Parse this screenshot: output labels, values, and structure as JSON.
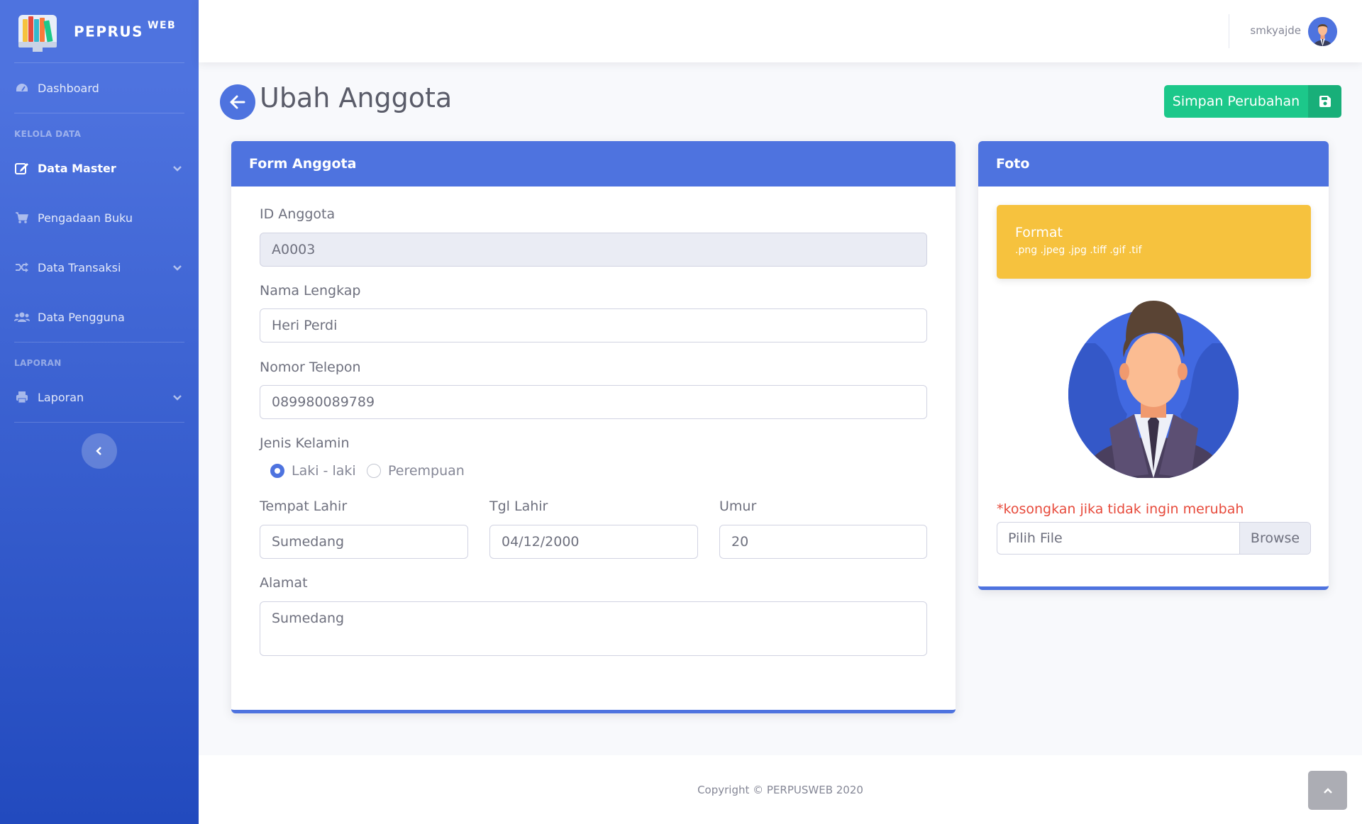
{
  "brand": {
    "name": "PEPRUS",
    "sup": "WEB"
  },
  "sidebar": {
    "dashboard": "Dashboard",
    "heading_kelola": "KELOLA DATA",
    "data_master": "Data Master",
    "pengadaan_buku": "Pengadaan Buku",
    "data_transaksi": "Data Transaksi",
    "data_pengguna": "Data Pengguna",
    "heading_laporan": "LAPORAN",
    "laporan": "Laporan"
  },
  "topbar": {
    "username": "smkyajde"
  },
  "page": {
    "title": "Ubah Anggota",
    "save_label": "Simpan Perubahan"
  },
  "form": {
    "header": "Form Anggota",
    "id_label": "ID Anggota",
    "id_value": "A0003",
    "nama_label": "Nama Lengkap",
    "nama_value": "Heri Perdi",
    "telp_label": "Nomor Telepon",
    "telp_value": "089980089789",
    "jk_label": "Jenis Kelamin",
    "jk_options": [
      "Laki - laki",
      "Perempuan"
    ],
    "jk_selected": "Laki - laki",
    "tempat_label": "Tempat Lahir",
    "tempat_value": "Sumedang",
    "tgl_label": "Tgl Lahir",
    "tgl_value": "04/12/2000",
    "umur_label": "Umur",
    "umur_value": "20",
    "alamat_label": "Alamat",
    "alamat_value": "Sumedang"
  },
  "foto": {
    "header": "Foto",
    "format_title": "Format",
    "format_list": ".png .jpeg .jpg .tiff .gif .tif",
    "note": "*kosongkan jika tidak ingin merubah",
    "file_placeholder": "Pilih File",
    "browse_label": "Browse"
  },
  "footer": {
    "copyright": "Copyright © PERPUSWEB 2020"
  },
  "colors": {
    "primary": "#4e73df",
    "success": "#1cc88a",
    "warning": "#f6c23e",
    "danger": "#e74a3b"
  },
  "icons": [
    "books-logo-icon",
    "tachometer-icon",
    "edit-icon",
    "cart-icon",
    "random-icon",
    "users-icon",
    "print-icon",
    "chevron-down-icon",
    "chevron-left-icon",
    "arrow-left-icon",
    "save-icon",
    "chevron-up-icon",
    "user-avatar-icon"
  ]
}
